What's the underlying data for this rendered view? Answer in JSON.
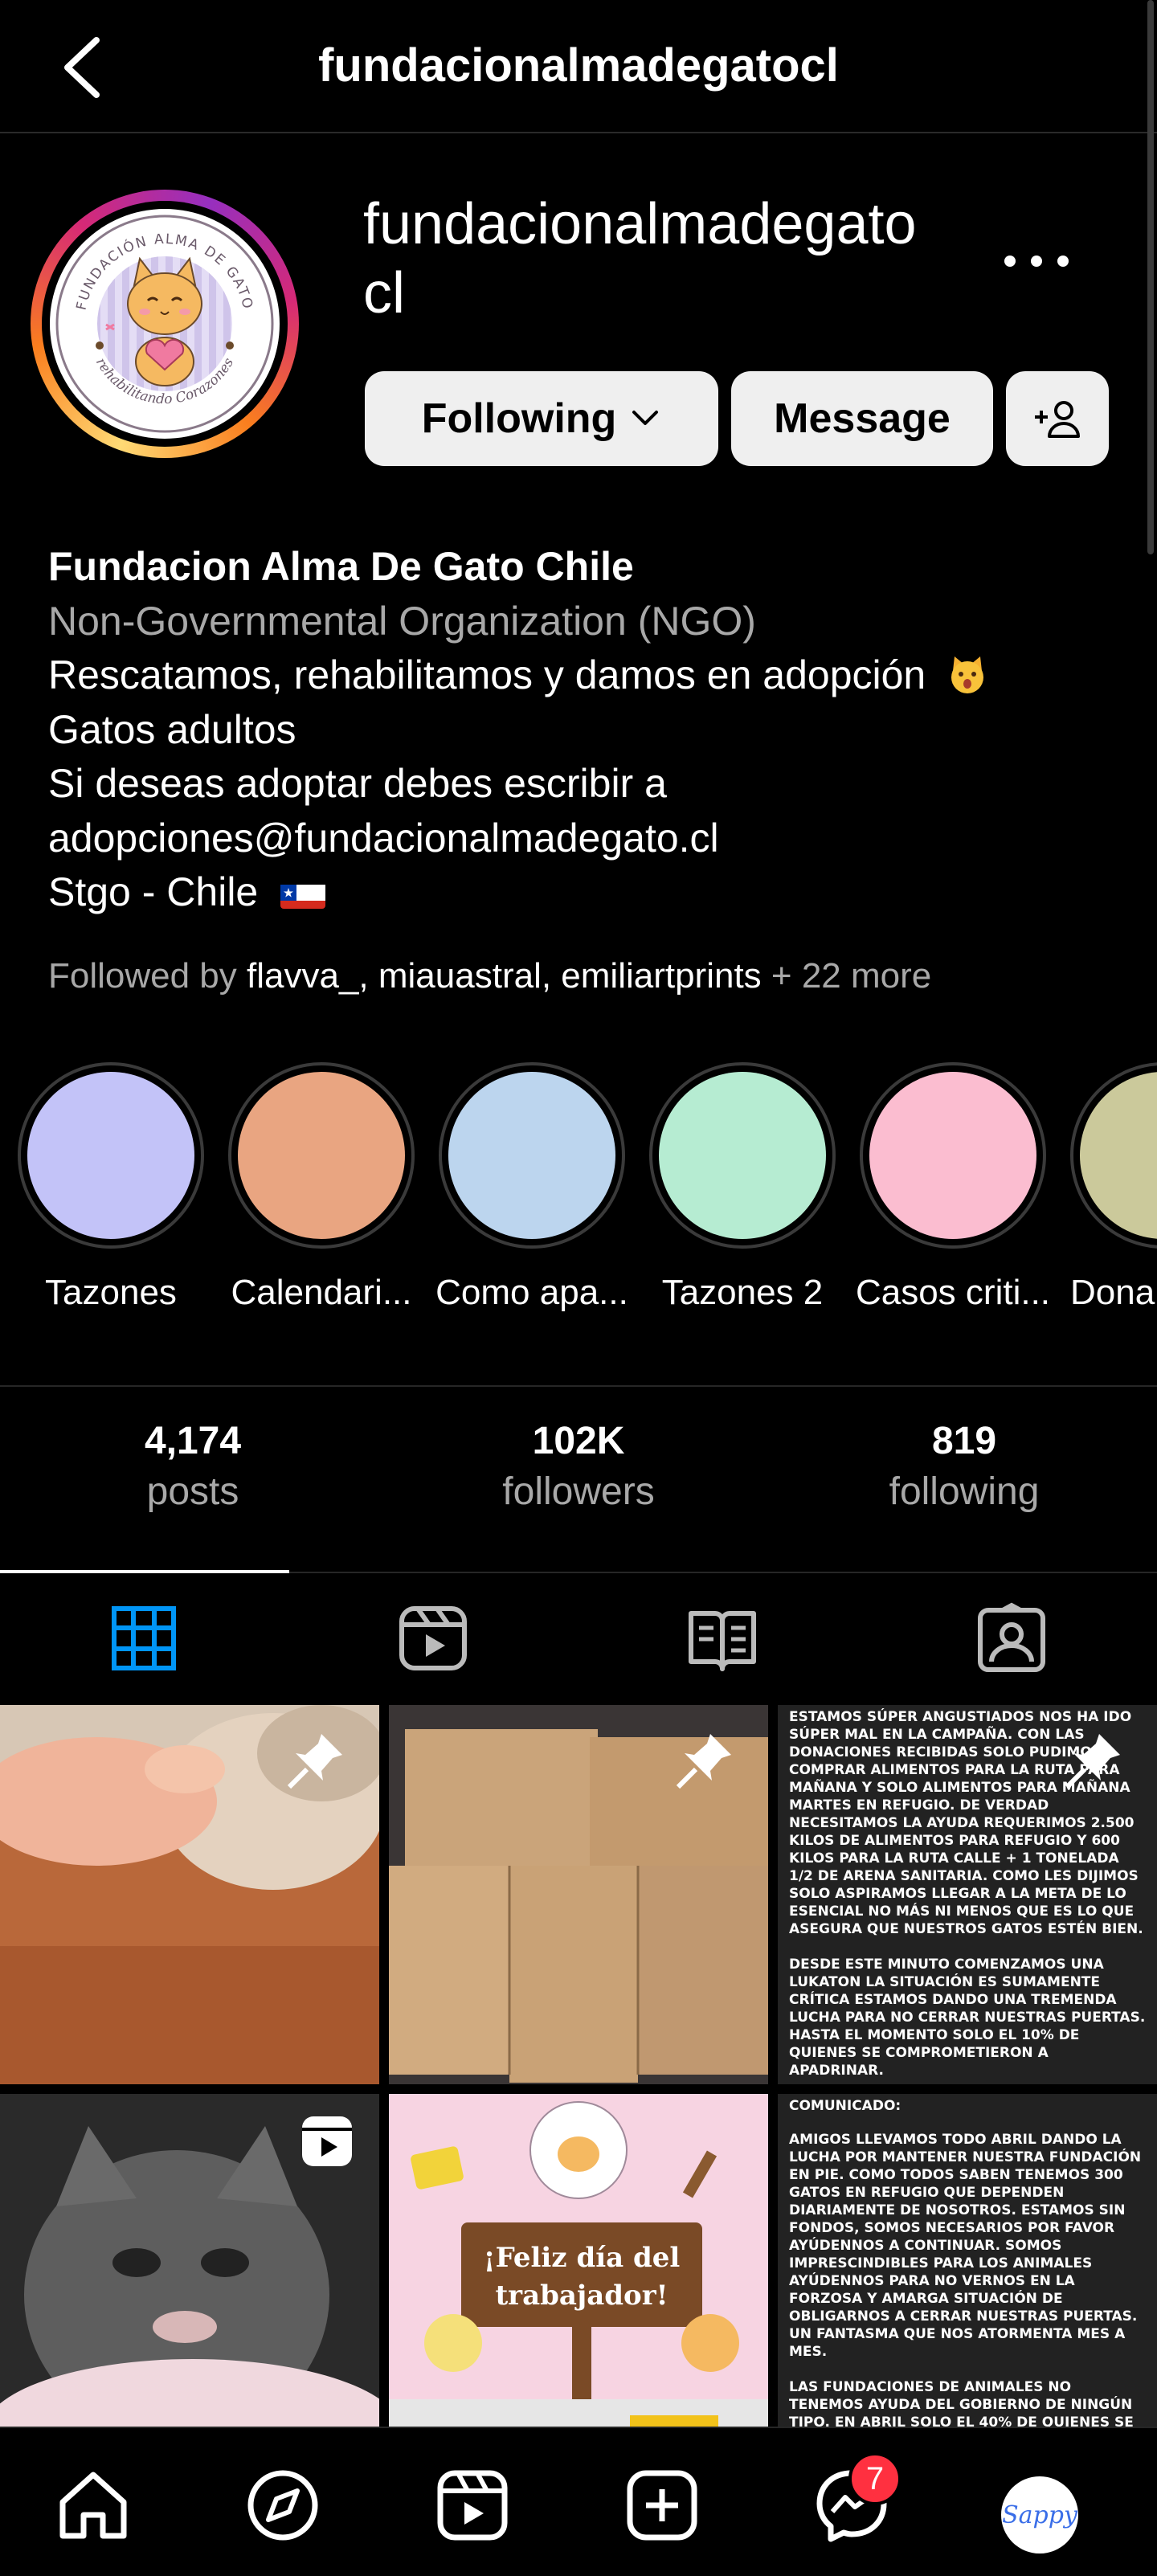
{
  "topbar": {
    "title": "fundacionalmadegatocl"
  },
  "profile": {
    "username": "fundacionalmadegatocl",
    "username_line1": "fundacionalmadegato",
    "username_line2": "cl",
    "logo_text_top": "FUNDACIÓN ALMA DE GATO",
    "logo_text_bottom": "rehabilitando Corazones",
    "buttons": {
      "following": "Following",
      "message": "Message"
    }
  },
  "bio": {
    "name": "Fundacion Alma De Gato Chile",
    "category": "Non-Governmental Organization (NGO)",
    "line1": "Rescatamos, rehabilitamos y damos en adopción",
    "line2": "Gatos adultos",
    "line3": "Si deseas adoptar debes escribir a",
    "line4": "adopciones@fundacionalmadegato.cl",
    "line5": "Stgo - Chile"
  },
  "followed_by": {
    "prefix": "Followed by ",
    "names": "flavva_, miauastral, emiliartprints",
    "suffix": " + 22 more"
  },
  "highlights": [
    {
      "label": "Tazones",
      "color": "#c3c3f8"
    },
    {
      "label": "Calendari...",
      "color": "#e9a581"
    },
    {
      "label": "Como apa...",
      "color": "#bcd5ee"
    },
    {
      "label": "Tazones 2",
      "color": "#b6ecd2"
    },
    {
      "label": "Casos criti...",
      "color": "#fbbdd0"
    },
    {
      "label": "Donar",
      "color": "#cbc99b"
    }
  ],
  "stats": {
    "posts": {
      "value": "4,174",
      "label": "posts"
    },
    "followers": {
      "value": "102K",
      "label": "followers"
    },
    "following": {
      "value": "819",
      "label": "following"
    }
  },
  "tabs": [
    "grid-icon",
    "reels-icon",
    "guides-icon",
    "tagged-icon"
  ],
  "posts": {
    "text_post_1": [
      "ESTAMOS SÚPER ANGUSTIADOS NOS HA IDO SÚPER MAL EN LA CAMPAÑA. CON LAS DONACIONES RECIBIDAS SOLO PUDIMOS COMPRAR ALIMENTOS PARA LA RUTA PARA MAÑANA Y SOLO ALIMENTOS PARA MAÑANA MARTES EN REFUGIO. DE VERDAD NECESITAMOS LA AYUDA REQUERIMOS 2.500 KILOS DE ALIMENTOS PARA REFUGIO Y 600 KILOS PARA LA RUTA CALLE + 1 TONELADA 1/2 DE ARENA SANITARIA. COMO LES DIJIMOS SOLO ASPIRAMOS LLEGAR A LA META DE LO ESENCIAL NO MÁS NI MENOS QUE ES LO QUE ASEGURA QUE NUESTROS GATOS ESTÉN BIEN.",
      "DESDE ESTE MINUTO COMENZAMOS UNA LUKATON LA SITUACIÓN ES SUMAMENTE CRÍTICA ESTAMOS DANDO UNA TREMENDA LUCHA PARA NO CERRAR NUESTRAS PUERTAS. HASTA EL MOMENTO SOLO EL 10% DE QUIENES SE COMPROMETIERON A APADRINAR."
    ],
    "text_post_2": [
      "COMUNICADO:",
      "AMIGOS LLEVAMOS TODO ABRIL DANDO LA LUCHA POR MANTENER NUESTRA FUNDACIÓN EN PIE. COMO TODOS SABEN TENEMOS 300 GATOS EN REFUGIO QUE DEPENDEN DIARIAMENTE DE NOSOTROS. ESTAMOS SIN FONDOS, SOMOS NECESARIOS POR FAVOR AYÚDENNOS A CONTINUAR. SOMOS IMPRESCINDIBLES PARA LOS ANIMALES AYÚDENNOS PARA NO VERNOS EN LA FORZOSA Y AMARGA SITUACIÓN DE OBLIGARNOS A CERRAR NUESTRAS PUERTAS. UN FANTASMA QUE NOS ATORMENTA MES A MES.",
      "LAS FUNDACIONES DE ANIMALES NO TENEMOS AYUDA DEL GOBIERNO DE NINGÚN TIPO. EN ABRIL SOLO EL 40% DE QUIENES SE COMPROMETIERON A APADRINAR DIERON SU AYUDA MENSUAL. ESTAMOS CRÍTICOS LA COMIDA SE TERMINA MAÑANA ESTAMOS"
    ],
    "worker_day_line1": "¡Feliz día del",
    "worker_day_line2": "trabajador!"
  },
  "bottomnav": {
    "items": [
      "home-icon",
      "explore-icon",
      "reels-icon",
      "create-icon",
      "messenger-icon",
      "profile-avatar"
    ],
    "messenger_badge": "7",
    "avatar_text": "Sappy"
  },
  "colors": {
    "accent_blue": "#0095f6",
    "badge_red": "#ff3040",
    "button_bg": "#efefef"
  }
}
